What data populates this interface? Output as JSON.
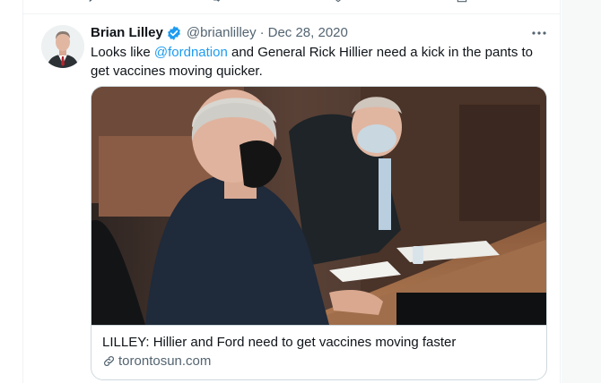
{
  "tweet": {
    "author": {
      "display_name": "Brian Lilley",
      "handle": "@brianlilley",
      "verified": true
    },
    "separator": "·",
    "date": "Dec 28, 2020",
    "text_before": "Looks like ",
    "mention": "@fordnation",
    "text_after": " and General Rick Hillier need a kick in the pants to get vaccines moving quicker.",
    "card": {
      "title": "LILLEY: Hillier and Ford need to get vaccines moving faster",
      "domain": "torontosun.com"
    }
  },
  "icons": [
    "verified-badge-icon",
    "more-options-icon",
    "link-icon"
  ],
  "colors": {
    "accent": "#1d9bf0",
    "secondary_text": "#536471",
    "border": "#cfd9de"
  }
}
